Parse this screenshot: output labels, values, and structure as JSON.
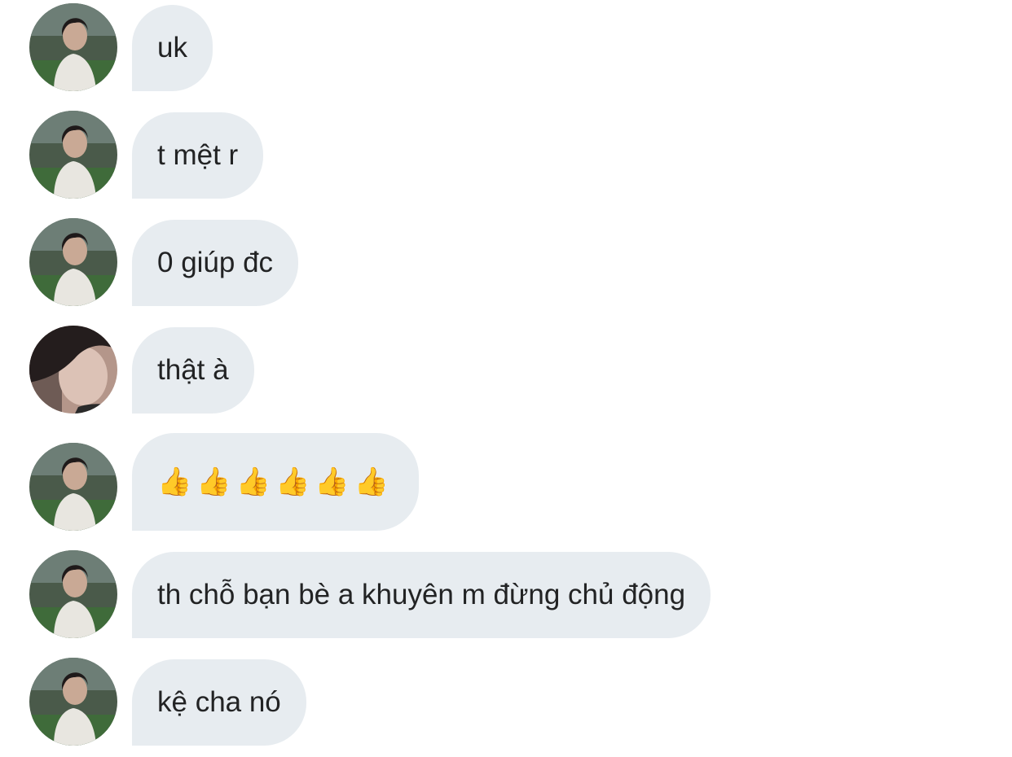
{
  "chat": {
    "messages": [
      {
        "sender": "a",
        "avatar": "landscape-avatar-icon",
        "text": "uk"
      },
      {
        "sender": "a",
        "avatar": "landscape-avatar-icon",
        "text": "t mệt r"
      },
      {
        "sender": "a",
        "avatar": "landscape-avatar-icon",
        "text": "0 giúp đc"
      },
      {
        "sender": "b",
        "avatar": "portrait-avatar-icon",
        "text": "thật à"
      },
      {
        "sender": "a",
        "avatar": "landscape-avatar-icon",
        "text": "👍👍👍👍👍👍"
      },
      {
        "sender": "a",
        "avatar": "landscape-avatar-icon",
        "text": "th chỗ bạn bè a khuyên m đừng chủ động"
      },
      {
        "sender": "a",
        "avatar": "landscape-avatar-icon",
        "text": "kệ cha nó"
      }
    ]
  },
  "colors": {
    "bubble": "#e7ecf0",
    "text": "#222324",
    "background": "#ffffff"
  }
}
